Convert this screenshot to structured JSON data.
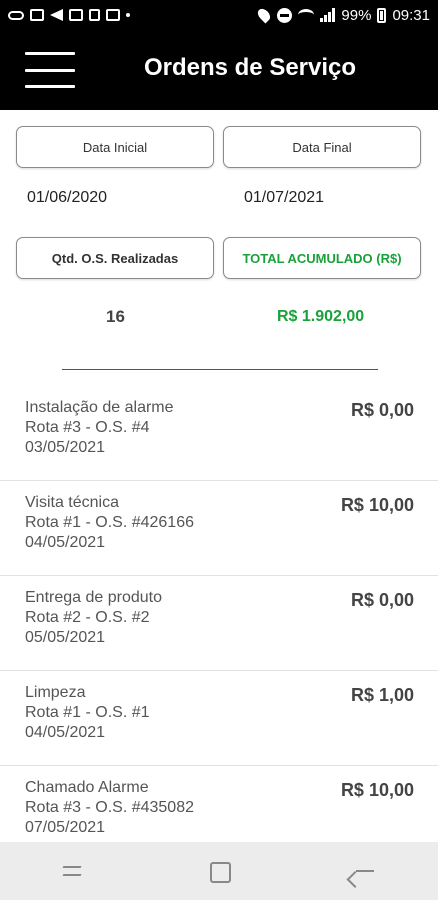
{
  "status_bar": {
    "battery": "99%",
    "time": "09:31"
  },
  "app_bar": {
    "title": "Ordens de Serviço"
  },
  "filters": {
    "start_label": "Data Inicial",
    "end_label": "Data Final",
    "start_value": "01/06/2020",
    "end_value": "01/07/2021",
    "count_label": "Qtd. O.S. Realizadas",
    "total_label": "TOTAL ACUMULADO (R$)",
    "count_value": "16",
    "total_value": "R$ 1.902,00"
  },
  "orders": [
    {
      "title": "Instalação de alarme",
      "sub": "Rota #3 - O.S. #4",
      "date": "03/05/2021",
      "value": "R$ 0,00"
    },
    {
      "title": "Visita técnica",
      "sub": "Rota #1 - O.S. #426166",
      "date": "04/05/2021",
      "value": "R$ 10,00"
    },
    {
      "title": "Entrega de produto",
      "sub": "Rota #2 - O.S. #2",
      "date": "05/05/2021",
      "value": "R$ 0,00"
    },
    {
      "title": "Limpeza",
      "sub": "Rota #1 - O.S. #1",
      "date": "04/05/2021",
      "value": "R$ 1,00"
    },
    {
      "title": "Chamado Alarme",
      "sub": "Rota #3 - O.S. #435082",
      "date": "07/05/2021",
      "value": "R$ 10,00"
    }
  ],
  "colors": {
    "app_bar": "#000000",
    "accent_green": "#1aa23a",
    "nav_bar": "#ececec"
  }
}
